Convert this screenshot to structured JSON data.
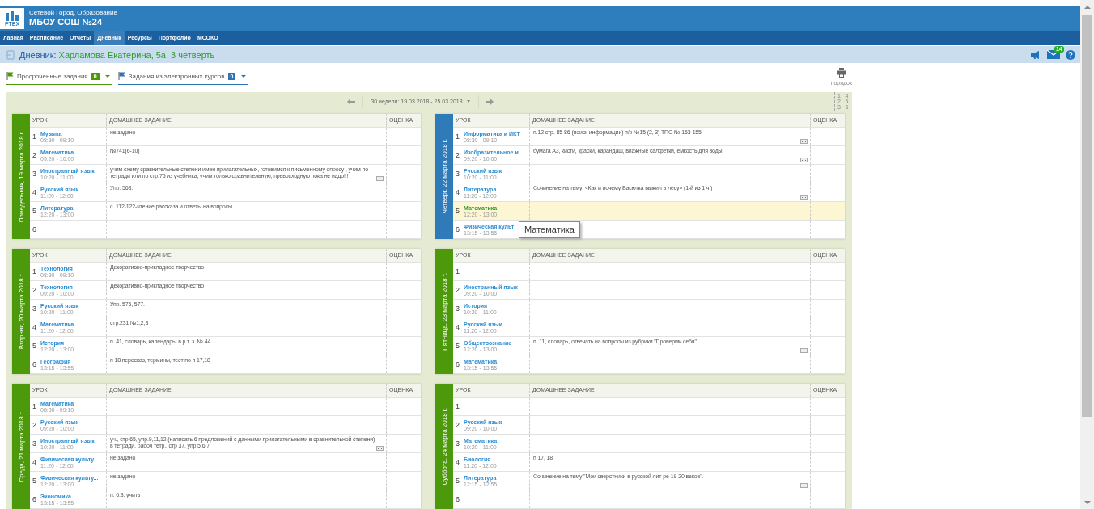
{
  "header": {
    "logo_text": "РТЕХ",
    "system": "Сетевой Город. Образование",
    "school": "МБОУ СОШ №24"
  },
  "nav": [
    {
      "label": "лавная",
      "selected": false
    },
    {
      "label": "Расписание",
      "selected": false
    },
    {
      "label": "Отчеты",
      "selected": false
    },
    {
      "label": "Дневник",
      "selected": true
    },
    {
      "label": "Ресурсы",
      "selected": false
    },
    {
      "label": "Портфолио",
      "selected": false
    },
    {
      "label": "МСОКО",
      "selected": false
    }
  ],
  "breadcrumb": {
    "section": "Дневник:",
    "student": "Харламова Екатерина, 5а, 3 четверть"
  },
  "mail_badge": "14",
  "filters": [
    {
      "label": "Просроченные задания",
      "count": "0",
      "color": "#4c9a0c"
    },
    {
      "label": "Задания из электронных курсов",
      "count": "0",
      "color": "#2f73b5"
    }
  ],
  "print_label": "порядок",
  "week": {
    "label": "30 недели: 19.03.2018 - 25.03.2018"
  },
  "order_grid": [
    "1",
    "2",
    "3",
    "4",
    "5",
    "6"
  ],
  "days": [
    {
      "title": "Понедельник, 19 марта 2018 г.",
      "current": false,
      "columns": [
        "УРОК",
        "ДОМАШНЕЕ ЗАДАНИЕ",
        "ОЦЕНКА"
      ],
      "lessons": [
        {
          "num": "1",
          "subject": "Музыка",
          "time": "08:30 - 09:10",
          "homework": "не задано",
          "comment": false,
          "highlighted": false
        },
        {
          "num": "2",
          "subject": "Математика",
          "time": "09:20 - 10:00",
          "homework": "№741(6-10)",
          "comment": false,
          "highlighted": false
        },
        {
          "num": "3",
          "subject": "Иностранный язык",
          "time": "10:20 - 11:00",
          "homework": "учим схему сравнительные степени имен прилагательных, готовимся к письменному опросу , учим по тетради или по стр.75 из учебника, учим только сравнительную, превосходную пока не надо!!!",
          "comment": true,
          "highlighted": false
        },
        {
          "num": "4",
          "subject": "Русский язык",
          "time": "11:20 - 12:00",
          "homework": "Упр. 568.",
          "comment": false,
          "highlighted": false
        },
        {
          "num": "5",
          "subject": "Литература",
          "time": "12:20 - 13:00",
          "homework": "с. 112-122-чтение рассказа и ответы на вопросы.",
          "comment": false,
          "highlighted": false
        },
        {
          "num": "6",
          "comment": false,
          "highlighted": false
        }
      ]
    },
    {
      "title": "Вторник, 20 марта 2018 г.",
      "current": false,
      "columns": [
        "УРОК",
        "ДОМАШНЕЕ ЗАДАНИЕ",
        "ОЦЕНКА"
      ],
      "lessons": [
        {
          "num": "1",
          "subject": "Технология",
          "time": "08:30 - 09:10",
          "homework": "Декоративно-прикладное творчество",
          "comment": false,
          "highlighted": false
        },
        {
          "num": "2",
          "subject": "Технология",
          "time": "09:20 - 10:00",
          "homework": "Декоративно-прикладное творчество",
          "comment": false,
          "highlighted": false
        },
        {
          "num": "3",
          "subject": "Русский язык",
          "time": "10:20 - 11:00",
          "homework": "Упр. 575, 577.",
          "comment": false,
          "highlighted": false
        },
        {
          "num": "4",
          "subject": "Математика",
          "time": "11:20 - 12:00",
          "homework": "стр.231 №1,2,3",
          "comment": false,
          "highlighted": false
        },
        {
          "num": "5",
          "subject": "История",
          "time": "12:20 - 13:00",
          "homework": "п. 41, словарь, календарь, в р.т. з. № 44",
          "comment": false,
          "highlighted": false
        },
        {
          "num": "6",
          "subject": "География",
          "time": "13:15 - 13:55",
          "homework": "п 18 пересказ, термины, тест по п 17,18",
          "comment": false,
          "highlighted": false
        }
      ]
    },
    {
      "title": "Среда, 21 марта 2018 г.",
      "current": false,
      "columns": [
        "УРОК",
        "ДОМАШНЕЕ ЗАДАНИЕ",
        "ОЦЕНКА"
      ],
      "lessons": [
        {
          "num": "1",
          "subject": "Математика",
          "time": "08:30 - 09:10",
          "comment": false,
          "highlighted": false
        },
        {
          "num": "2",
          "subject": "Русский язык",
          "time": "09:20 - 10:00",
          "comment": false,
          "highlighted": false
        },
        {
          "num": "3",
          "subject": "Иностранный язык",
          "time": "10:20 - 11:00",
          "homework": "уч., стр.65, упр.9,11,12 (написать 6 предложений с данными прилагательными в сравнительной степени) в тетради, рабоч тетр., стр 37, упр 5,6,7",
          "comment": true,
          "highlighted": false
        },
        {
          "num": "4",
          "subject": "Физическая культу...",
          "time": "11:20 - 12:00",
          "homework": "не задано",
          "comment": false,
          "highlighted": false
        },
        {
          "num": "5",
          "subject": "Физическая культу...",
          "time": "12:20 - 13:00",
          "homework": "не задано",
          "comment": false,
          "highlighted": false
        },
        {
          "num": "6",
          "subject": "Экономика",
          "time": "13:15 - 13:55",
          "homework": "п. 6.3. учить",
          "comment": false,
          "highlighted": false
        }
      ]
    },
    {
      "title": "Четверг, 22 марта 2018 г.",
      "current": true,
      "columns": [
        "УРОК",
        "ДОМАШНЕЕ ЗАДАНИЕ",
        "ОЦЕНКА"
      ],
      "lessons": [
        {
          "num": "1",
          "subject": "Информатика и ИКТ",
          "time": "08:30 - 09:10",
          "homework": "п.12 стр. 85-86 (поиск информации) п/р №15 (2, 3) ТПО № 153-155",
          "comment": true,
          "highlighted": false
        },
        {
          "num": "2",
          "subject": "Изобразительное и...",
          "time": "09:20 - 10:00",
          "homework": "бумага А3, кисти, краски, карандаш, влажные салфетки, емкость для воды",
          "comment": true,
          "highlighted": false
        },
        {
          "num": "3",
          "subject": "Русский язык",
          "time": "10:20 - 11:00",
          "comment": false,
          "highlighted": false
        },
        {
          "num": "4",
          "subject": "Литература",
          "time": "11:20 - 12:00",
          "homework": "Сочинение на тему: «Как и почему Васютка выжил в лесу» (1-й из 1 ч.)",
          "comment": true,
          "highlighted": false
        },
        {
          "num": "5",
          "subject": "Математика",
          "time": "12:20 - 13:00",
          "comment": false,
          "highlighted": true
        },
        {
          "num": "6",
          "subject": "Физическая культ",
          "time": "13:15 - 13:55",
          "comment": false,
          "highlighted": false
        }
      ]
    },
    {
      "title": "Пятница, 23 марта 2018 г.",
      "current": false,
      "columns": [
        "УРОК",
        "ДОМАШНЕЕ ЗАДАНИЕ",
        "ОЦЕНКА"
      ],
      "lessons": [
        {
          "num": "1",
          "comment": false,
          "highlighted": false
        },
        {
          "num": "2",
          "subject": "Иностранный язык",
          "time": "09:20 - 10:00",
          "comment": false,
          "highlighted": false
        },
        {
          "num": "3",
          "subject": "История",
          "time": "10:20 - 11:00",
          "comment": false,
          "highlighted": false
        },
        {
          "num": "4",
          "subject": "Русский язык",
          "time": "11:20 - 12:00",
          "comment": false,
          "highlighted": false
        },
        {
          "num": "5",
          "subject": "Обществознание",
          "time": "12:20 - 13:00",
          "homework": "п. 11, словарь, отвечать на вопросы из рубрики \"Проверим себя\"",
          "comment": true,
          "highlighted": false
        },
        {
          "num": "6",
          "subject": "Математика",
          "time": "13:15 - 13:55",
          "comment": false,
          "highlighted": false
        }
      ]
    },
    {
      "title": "Суббота, 24 марта 2018 г.",
      "current": false,
      "columns": [
        "УРОК",
        "ДОМАШНЕЕ ЗАДАНИЕ",
        "ОЦЕНКА"
      ],
      "lessons": [
        {
          "num": "1",
          "comment": false,
          "highlighted": false
        },
        {
          "num": "2",
          "subject": "Русский язык",
          "time": "09:20 - 10:00",
          "comment": false,
          "highlighted": false
        },
        {
          "num": "3",
          "subject": "Математика",
          "time": "10:20 - 11:00",
          "comment": false,
          "highlighted": false
        },
        {
          "num": "4",
          "subject": "Биология",
          "time": "11:20 - 12:00",
          "homework": "п 17, 18",
          "comment": false,
          "highlighted": false
        },
        {
          "num": "5",
          "subject": "Литература",
          "time": "12:15 - 12:55",
          "homework": "Сочинение на тему:\"Мои сверстники в русской лит-ре 19-20 веков\".",
          "comment": true,
          "highlighted": false
        },
        {
          "num": "6",
          "comment": false,
          "highlighted": false
        }
      ]
    }
  ],
  "tooltip": {
    "text": "Математика"
  }
}
